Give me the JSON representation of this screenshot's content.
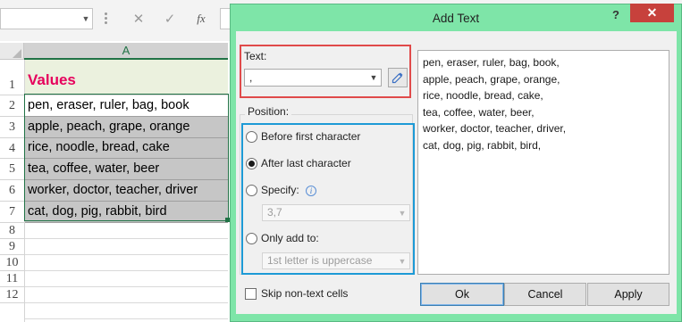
{
  "excel": {
    "formula_bar": {
      "cancel_icon": "✕",
      "enter_icon": "✓",
      "fx_label": "fx"
    },
    "column_header": "A",
    "row_numbers": [
      "1",
      "2",
      "3",
      "4",
      "5",
      "6",
      "7",
      "8",
      "9",
      "10",
      "11",
      "12"
    ],
    "header_cell": "Values",
    "cells": [
      "pen, eraser, ruler, bag, book",
      "apple, peach, grape, orange",
      "rice, noodle, bread, cake",
      "tea, coffee, water, beer",
      "worker, doctor, teacher, driver",
      "cat, dog, pig, rabbit, bird"
    ],
    "colors": {
      "accent": "#217346",
      "header_text": "#e6005c",
      "header_fill": "#ebf1de",
      "selection": "#c6c6c6"
    }
  },
  "dialog": {
    "title": "Add Text",
    "help_label": "?",
    "close_label": "✕",
    "bg_color": "#7ee5a8",
    "text_section": {
      "label": "Text:",
      "value": ",",
      "picker_icon": "eyedropper-icon"
    },
    "position": {
      "label": "Position:",
      "options": [
        {
          "label": "Before first character",
          "selected": false
        },
        {
          "label": "After last character",
          "selected": true
        },
        {
          "label": "Specify:",
          "selected": false
        },
        {
          "label": "Only add to:",
          "selected": false
        }
      ],
      "specify_value": "3,7",
      "only_add_value": "1st letter is uppercase"
    },
    "preview_lines": [
      "pen, eraser, ruler, bag, book,",
      "apple, peach, grape, orange,",
      "rice, noodle, bread, cake,",
      "tea, coffee, water, beer,",
      "worker, doctor, teacher, driver,",
      "cat, dog, pig, rabbit, bird,"
    ],
    "skip_non_text_label": "Skip non-text cells",
    "buttons": {
      "ok": "Ok",
      "cancel": "Cancel",
      "apply": "Apply"
    },
    "highlight_colors": {
      "text_box": "#e04a4a",
      "position_box": "#1d9ad6"
    }
  }
}
